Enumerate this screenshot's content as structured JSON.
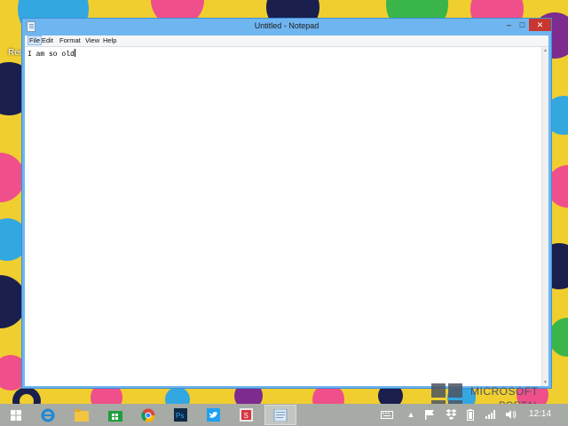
{
  "desktop": {
    "partial_icon_label": "Rec"
  },
  "window": {
    "title": "Untitled - Notepad",
    "controls": {
      "minimize": "–",
      "maximize": "□",
      "close": "✕"
    }
  },
  "menu": {
    "file": "File",
    "edit": "Edit",
    "format": "Format",
    "view": "View",
    "help": "Help"
  },
  "editor": {
    "text": "I am so old"
  },
  "taskbar": {
    "pinned": [
      "start-icon",
      "ie-icon",
      "file-explorer-icon",
      "store-icon",
      "chrome-icon",
      "photoshop-icon",
      "twitter-icon",
      "sway-icon",
      "notepad-icon"
    ],
    "tray_icons": [
      "keyboard-icon",
      "show-hidden-icon",
      "flag-icon",
      "dropbox-icon",
      "battery-icon",
      "signal-icon",
      "volume-icon"
    ],
    "clock": "12:14"
  },
  "watermark": {
    "line1": "MICROSOFT",
    "line2": "PORTAL"
  },
  "colors": {
    "titlebar": "#6fb5f0",
    "close": "#c7372f",
    "taskbar": "#a7aba6"
  }
}
